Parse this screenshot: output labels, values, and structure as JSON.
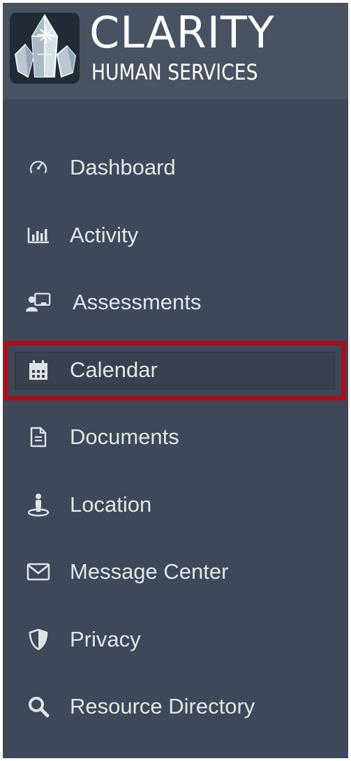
{
  "brand": {
    "name": "CLARITY",
    "subtitle": "HUMAN SERVICES"
  },
  "nav": {
    "items": [
      {
        "label": "Dashboard",
        "icon": "dashboard-gauge-icon"
      },
      {
        "label": "Activity",
        "icon": "bar-chart-icon"
      },
      {
        "label": "Assessments",
        "icon": "person-board-icon"
      },
      {
        "label": "Calendar",
        "icon": "calendar-icon",
        "selected": true
      },
      {
        "label": "Documents",
        "icon": "document-icon"
      },
      {
        "label": "Location",
        "icon": "location-person-icon"
      },
      {
        "label": "Message Center",
        "icon": "envelope-icon"
      },
      {
        "label": "Privacy",
        "icon": "shield-icon"
      },
      {
        "label": "Resource Directory",
        "icon": "search-icon"
      }
    ]
  },
  "colors": {
    "sidebar_bg": "#3f4858",
    "header_bg": "#485261",
    "text": "#e3e6ea",
    "selection_outline": "#a5121c"
  }
}
